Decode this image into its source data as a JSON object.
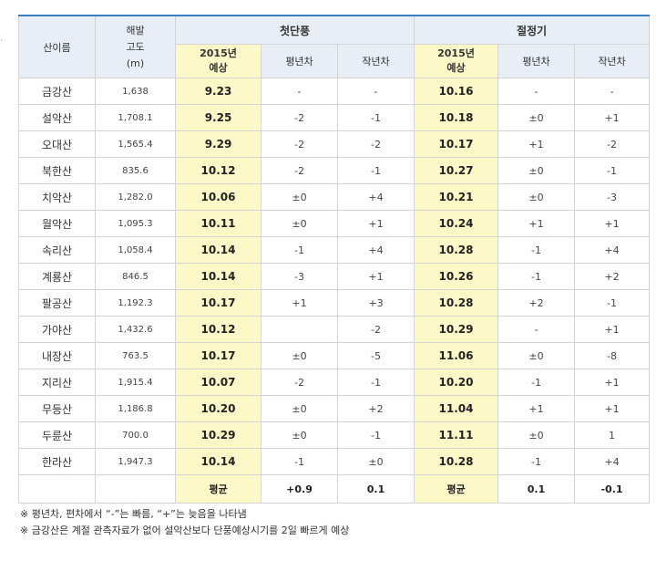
{
  "side_mark": "·",
  "header": {
    "mountain": "산이름",
    "altitude_line1": "해발",
    "altitude_line2": "고도",
    "altitude_line3": "(m)",
    "first_foliage": "첫단풍",
    "peak_foliage": "절정기",
    "forecast_line1": "2015년",
    "forecast_line2": "예상",
    "vs_normal": "평년차",
    "vs_last_year": "작년차"
  },
  "rows": [
    {
      "name": "금강산",
      "altitude": "1,638",
      "first": "9.23",
      "first_normal": "-",
      "first_last": "-",
      "peak": "10.16",
      "peak_normal": "-",
      "peak_last": "-"
    },
    {
      "name": "설악산",
      "altitude": "1,708.1",
      "first": "9.25",
      "first_normal": "-2",
      "first_last": "-1",
      "peak": "10.18",
      "peak_normal": "±0",
      "peak_last": "+1"
    },
    {
      "name": "오대산",
      "altitude": "1,565.4",
      "first": "9.29",
      "first_normal": "-2",
      "first_last": "-2",
      "peak": "10.17",
      "peak_normal": "+1",
      "peak_last": "-2"
    },
    {
      "name": "북한산",
      "altitude": "835.6",
      "first": "10.12",
      "first_normal": "-2",
      "first_last": "-1",
      "peak": "10.27",
      "peak_normal": "±0",
      "peak_last": "-1"
    },
    {
      "name": "치악산",
      "altitude": "1,282.0",
      "first": "10.06",
      "first_normal": "±0",
      "first_last": "+4",
      "peak": "10.21",
      "peak_normal": "±0",
      "peak_last": "-3"
    },
    {
      "name": "월악산",
      "altitude": "1,095.3",
      "first": "10.11",
      "first_normal": "±0",
      "first_last": "+1",
      "peak": "10.24",
      "peak_normal": "+1",
      "peak_last": "+1"
    },
    {
      "name": "속리산",
      "altitude": "1,058.4",
      "first": "10.14",
      "first_normal": "-1",
      "first_last": "+4",
      "peak": "10.28",
      "peak_normal": "-1",
      "peak_last": "+4"
    },
    {
      "name": "계룡산",
      "altitude": "846.5",
      "first": "10.14",
      "first_normal": "-3",
      "first_last": "+1",
      "peak": "10.26",
      "peak_normal": "-1",
      "peak_last": "+2"
    },
    {
      "name": "팔공산",
      "altitude": "1,192.3",
      "first": "10.17",
      "first_normal": "+1",
      "first_last": "+3",
      "peak": "10.28",
      "peak_normal": "+2",
      "peak_last": "-1"
    },
    {
      "name": "가야산",
      "altitude": "1,432.6",
      "first": "10.12",
      "first_normal": "",
      "first_last": "-2",
      "peak": "10.29",
      "peak_normal": "-",
      "peak_last": "+1"
    },
    {
      "name": "내장산",
      "altitude": "763.5",
      "first": "10.17",
      "first_normal": "±0",
      "first_last": "-5",
      "peak": "11.06",
      "peak_normal": "±0",
      "peak_last": "-8"
    },
    {
      "name": "지리산",
      "altitude": "1,915.4",
      "first": "10.07",
      "first_normal": "-2",
      "first_last": "-1",
      "peak": "10.20",
      "peak_normal": "-1",
      "peak_last": "+1"
    },
    {
      "name": "무등산",
      "altitude": "1,186.8",
      "first": "10.20",
      "first_normal": "±0",
      "first_last": "+2",
      "peak": "11.04",
      "peak_normal": "+1",
      "peak_last": "+1"
    },
    {
      "name": "두륜산",
      "altitude": "700.0",
      "first": "10.29",
      "first_normal": "±0",
      "first_last": "-1",
      "peak": "11.11",
      "peak_normal": "±0",
      "peak_last": "1"
    },
    {
      "name": "한라산",
      "altitude": "1,947.3",
      "first": "10.14",
      "first_normal": "-1",
      "first_last": "±0",
      "peak": "10.28",
      "peak_normal": "-1",
      "peak_last": "+4"
    }
  ],
  "average": {
    "label": "평균",
    "first_normal": "+0.9",
    "first_last": "0.1",
    "peak_normal": "0.1",
    "peak_last": "-0.1"
  },
  "notes": [
    "※ 평년차, 편차에서 “-”는 빠름, “+”는 늦음을 나타냄",
    "※ 금강산은 계절 관측자료가 없어 설악산보다 단풍예상시기를 2일 빠르게 예상"
  ],
  "colors": {
    "accent_line": "#3b7dc4",
    "header_bg": "#e8eef6",
    "forecast_bg": "#fdf8c7",
    "grid": "#d4d4d4"
  }
}
